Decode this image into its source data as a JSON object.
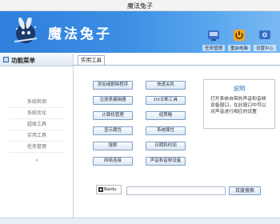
{
  "window": {
    "title": "魔法兔子"
  },
  "banner": {
    "app_name": "魔法兔子",
    "tools": [
      {
        "label": "任务管理",
        "icon": "task-manager-icon",
        "color": "#3a6fc4"
      },
      {
        "label": "重启电脑",
        "icon": "power-icon",
        "color": "#f3a51c"
      },
      {
        "label": "设置中心",
        "icon": "settings-icon",
        "color": "#3a6fc4"
      }
    ]
  },
  "sidebar": {
    "header": "功能菜单",
    "items": [
      "系统检测",
      "系统优化",
      "超级工具",
      "实用工具",
      "任务管理"
    ],
    "more_arrow": "»"
  },
  "main": {
    "tab": "实用工具",
    "buttons": [
      "添加或删除程序",
      "快速关机",
      "注册表编辑器",
      "DX诊断工具",
      "计算机管理",
      "组策略",
      "显示属性",
      "系统属性",
      "搜索",
      "日期和时间",
      "网络连接",
      "声音和音频设备"
    ],
    "description": {
      "title": "说明",
      "text": "打开系统自带的声音和音频设备窗口，在此窗口中可以对声音进行相应的设置"
    },
    "search": {
      "logo_text": "Baidu",
      "placeholder": "",
      "button": "百度搜索"
    }
  }
}
